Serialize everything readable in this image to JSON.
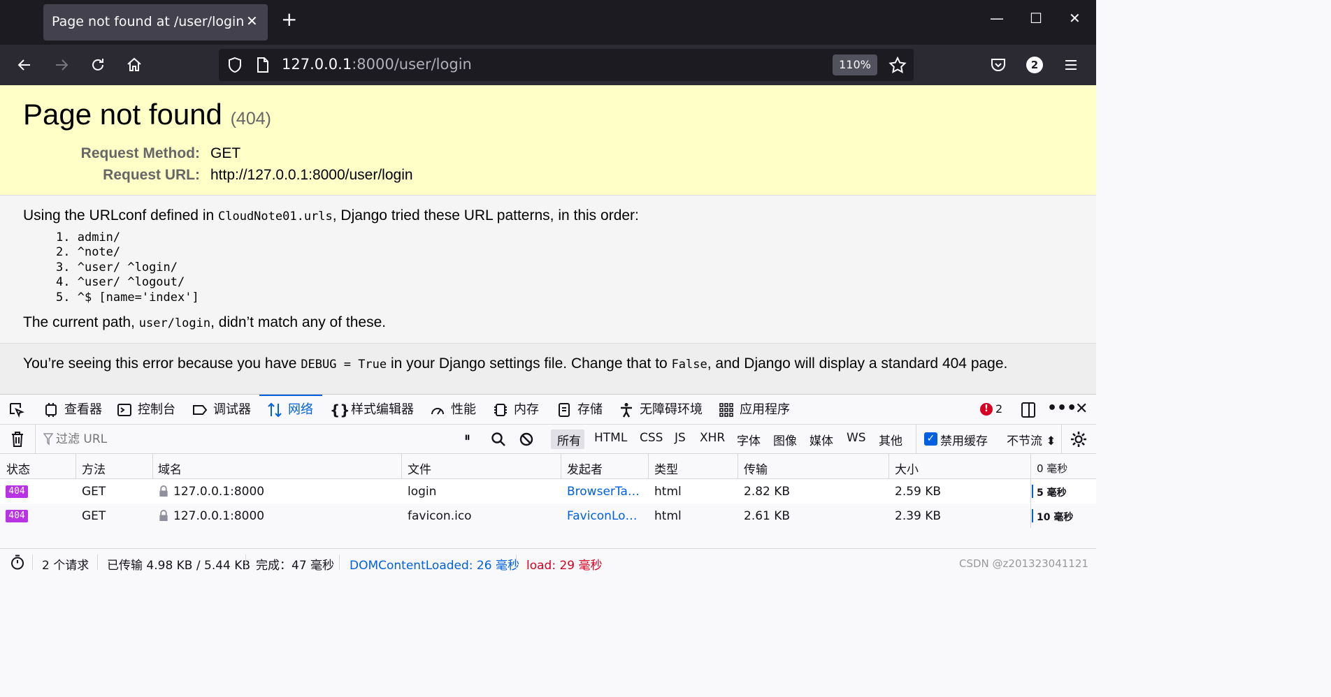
{
  "browser": {
    "tab_title": "Page not found at /user/login",
    "url_host": "127.0.0.1",
    "url_rest": ":8000/user/login",
    "zoom": "110%",
    "notification_count": "2"
  },
  "page": {
    "title": "Page not found",
    "code": "(404)",
    "request_method_label": "Request Method:",
    "request_method": "GET",
    "request_url_label": "Request URL:",
    "request_url": "http://127.0.0.1:8000/user/login",
    "urlconf_text_1": "Using the URLconf defined in ",
    "urlconf_module": "CloudNote01.urls",
    "urlconf_text_2": ", Django tried these URL patterns, in this order:",
    "patterns": [
      "admin/",
      "^note/",
      "^user/ ^login/",
      "^user/ ^logout/",
      "^$ [name='index']"
    ],
    "current_text_1": "The current path, ",
    "current_path": "user/login",
    "current_text_2": ", didn’t match any of these.",
    "explain_1": "You’re seeing this error because you have ",
    "explain_debug": "DEBUG = True",
    "explain_2": " in your Django settings file. Change that to ",
    "explain_false": "False",
    "explain_3": ", and Django will display a standard 404 page."
  },
  "devtools": {
    "tabs": [
      "查看器",
      "控制台",
      "调试器",
      "网络",
      "样式编辑器",
      "性能",
      "内存",
      "存储",
      "无障碍环境",
      "应用程序"
    ],
    "error_count": "2",
    "filter_placeholder": "过滤 URL",
    "filters": [
      "所有",
      "HTML",
      "CSS",
      "JS",
      "XHR",
      "字体",
      "图像",
      "媒体",
      "WS",
      "其他"
    ],
    "disable_cache": "禁用缓存",
    "throttle": "不节流",
    "columns": [
      "状态",
      "方法",
      "域名",
      "文件",
      "发起者",
      "类型",
      "传输",
      "大小",
      "0 毫秒"
    ],
    "rows": [
      {
        "status": "404",
        "method": "GET",
        "domain": "127.0.0.1:8000",
        "file": "login",
        "initiator": "BrowserTab...",
        "type": "html",
        "transferred": "2.82 KB",
        "size": "2.59 KB",
        "timing": "5 毫秒"
      },
      {
        "status": "404",
        "method": "GET",
        "domain": "127.0.0.1:8000",
        "file": "favicon.ico",
        "initiator": "FaviconLoad...",
        "type": "html",
        "transferred": "2.61 KB",
        "size": "2.39 KB",
        "timing": "10 毫秒"
      }
    ],
    "status_requests": "2 个请求",
    "status_transferred": "已传输 4.98 KB / 5.44 KB",
    "status_finish": "完成：47 毫秒",
    "status_dcl": "DOMContentLoaded: 26 毫秒",
    "status_load": "load: 29 毫秒",
    "watermark": "CSDN @z201323041121"
  },
  "colors": {
    "accent": "#0060df",
    "badge": "#b833e1",
    "load": "#d70022",
    "summary_bg": "#ffffc8"
  }
}
